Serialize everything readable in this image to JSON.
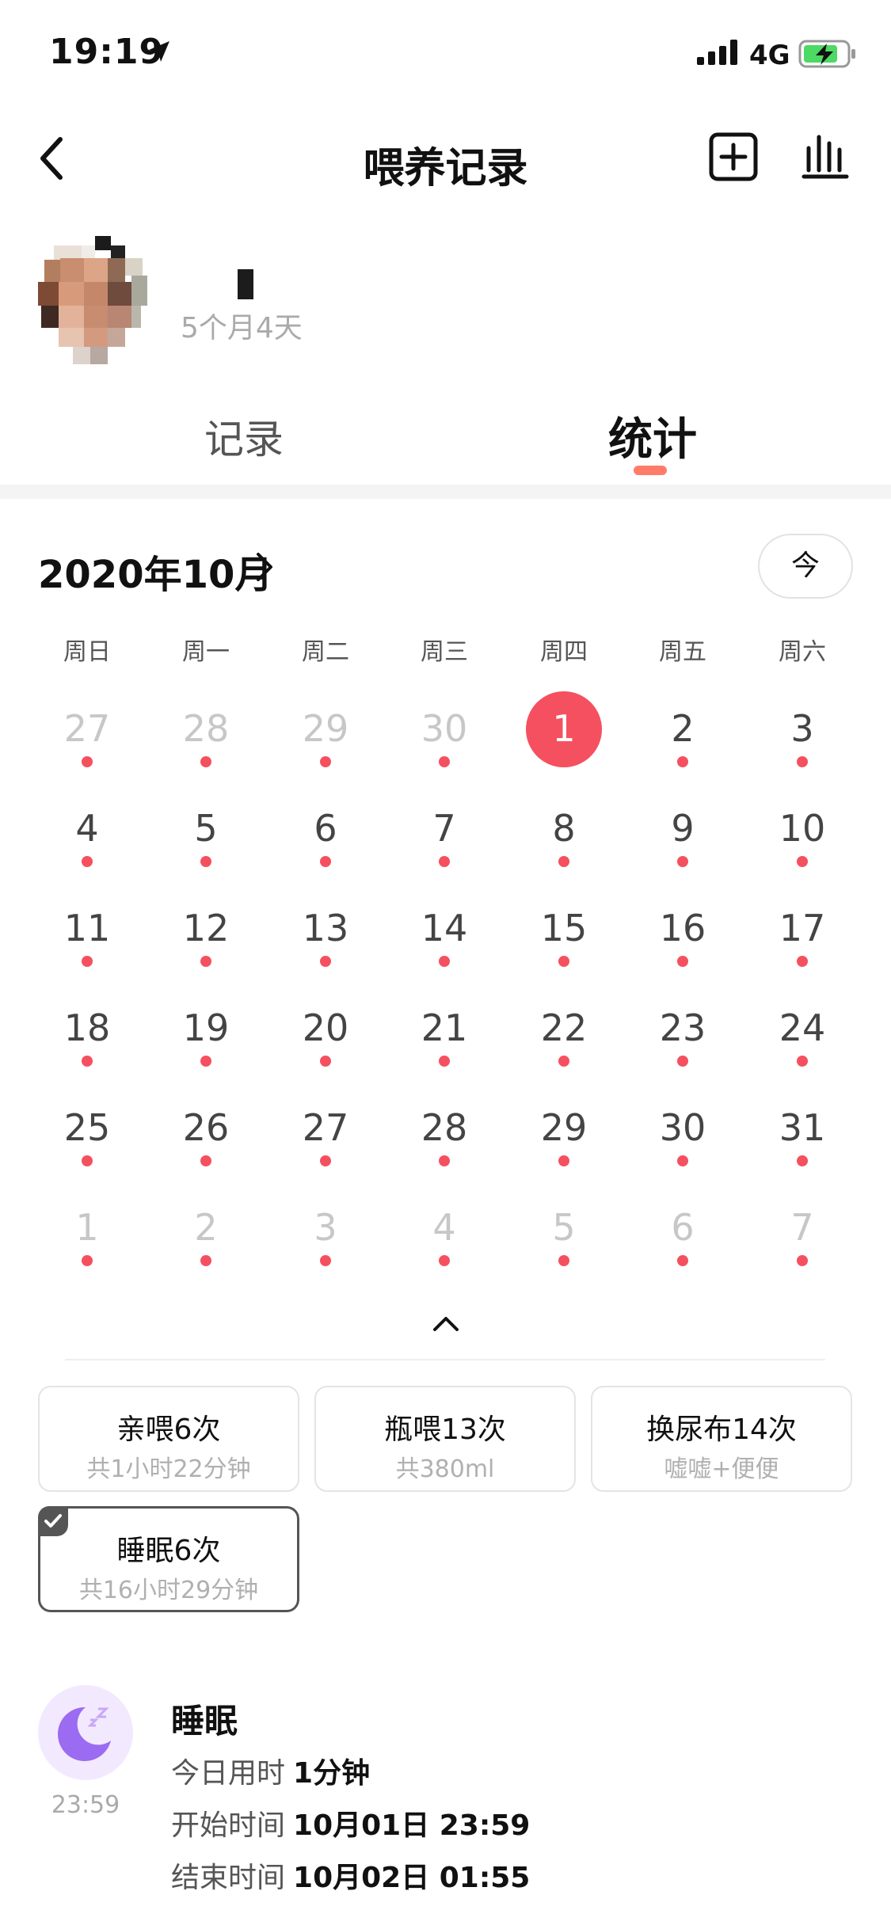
{
  "status_bar": {
    "time": "19:19",
    "network": "4G"
  },
  "nav": {
    "title": "喂养记录"
  },
  "profile": {
    "age": "5个月4天"
  },
  "tabs": [
    {
      "label": "记录"
    },
    {
      "label": "统计",
      "active": true
    }
  ],
  "calendar": {
    "month_label": "2020年10月",
    "today_label": "今",
    "weekdays": [
      "周日",
      "周一",
      "周二",
      "周三",
      "周四",
      "周五",
      "周六"
    ],
    "selected_day": "1",
    "weeks": [
      [
        "27",
        "28",
        "29",
        "30",
        "1",
        "2",
        "3"
      ],
      [
        "4",
        "5",
        "6",
        "7",
        "8",
        "9",
        "10"
      ],
      [
        "11",
        "12",
        "13",
        "14",
        "15",
        "16",
        "17"
      ],
      [
        "18",
        "19",
        "20",
        "21",
        "22",
        "23",
        "24"
      ],
      [
        "25",
        "26",
        "27",
        "28",
        "29",
        "30",
        "31"
      ],
      [
        "1",
        "2",
        "3",
        "4",
        "5",
        "6",
        "7"
      ]
    ]
  },
  "summary_cards": [
    {
      "title": "亲喂6次",
      "subtitle": "共1小时22分钟"
    },
    {
      "title": "瓶喂13次",
      "subtitle": "共380ml"
    },
    {
      "title": "换尿布14次",
      "subtitle": "嘘嘘+便便"
    },
    {
      "title": "睡眠6次",
      "subtitle": "共16小时29分钟",
      "selected": true
    }
  ],
  "detail": {
    "time": "23:59",
    "title": "睡眠",
    "rows": [
      {
        "label": "今日用时",
        "value": "1分钟"
      },
      {
        "label": "开始时间",
        "value": "10月01日 23:59"
      },
      {
        "label": "结束时间",
        "value": "10月02日 01:55"
      }
    ]
  },
  "colors": {
    "accent": "#f5505f",
    "tab_indicator": "#ff7c6b",
    "sleep_icon": "#9b6bf2"
  }
}
